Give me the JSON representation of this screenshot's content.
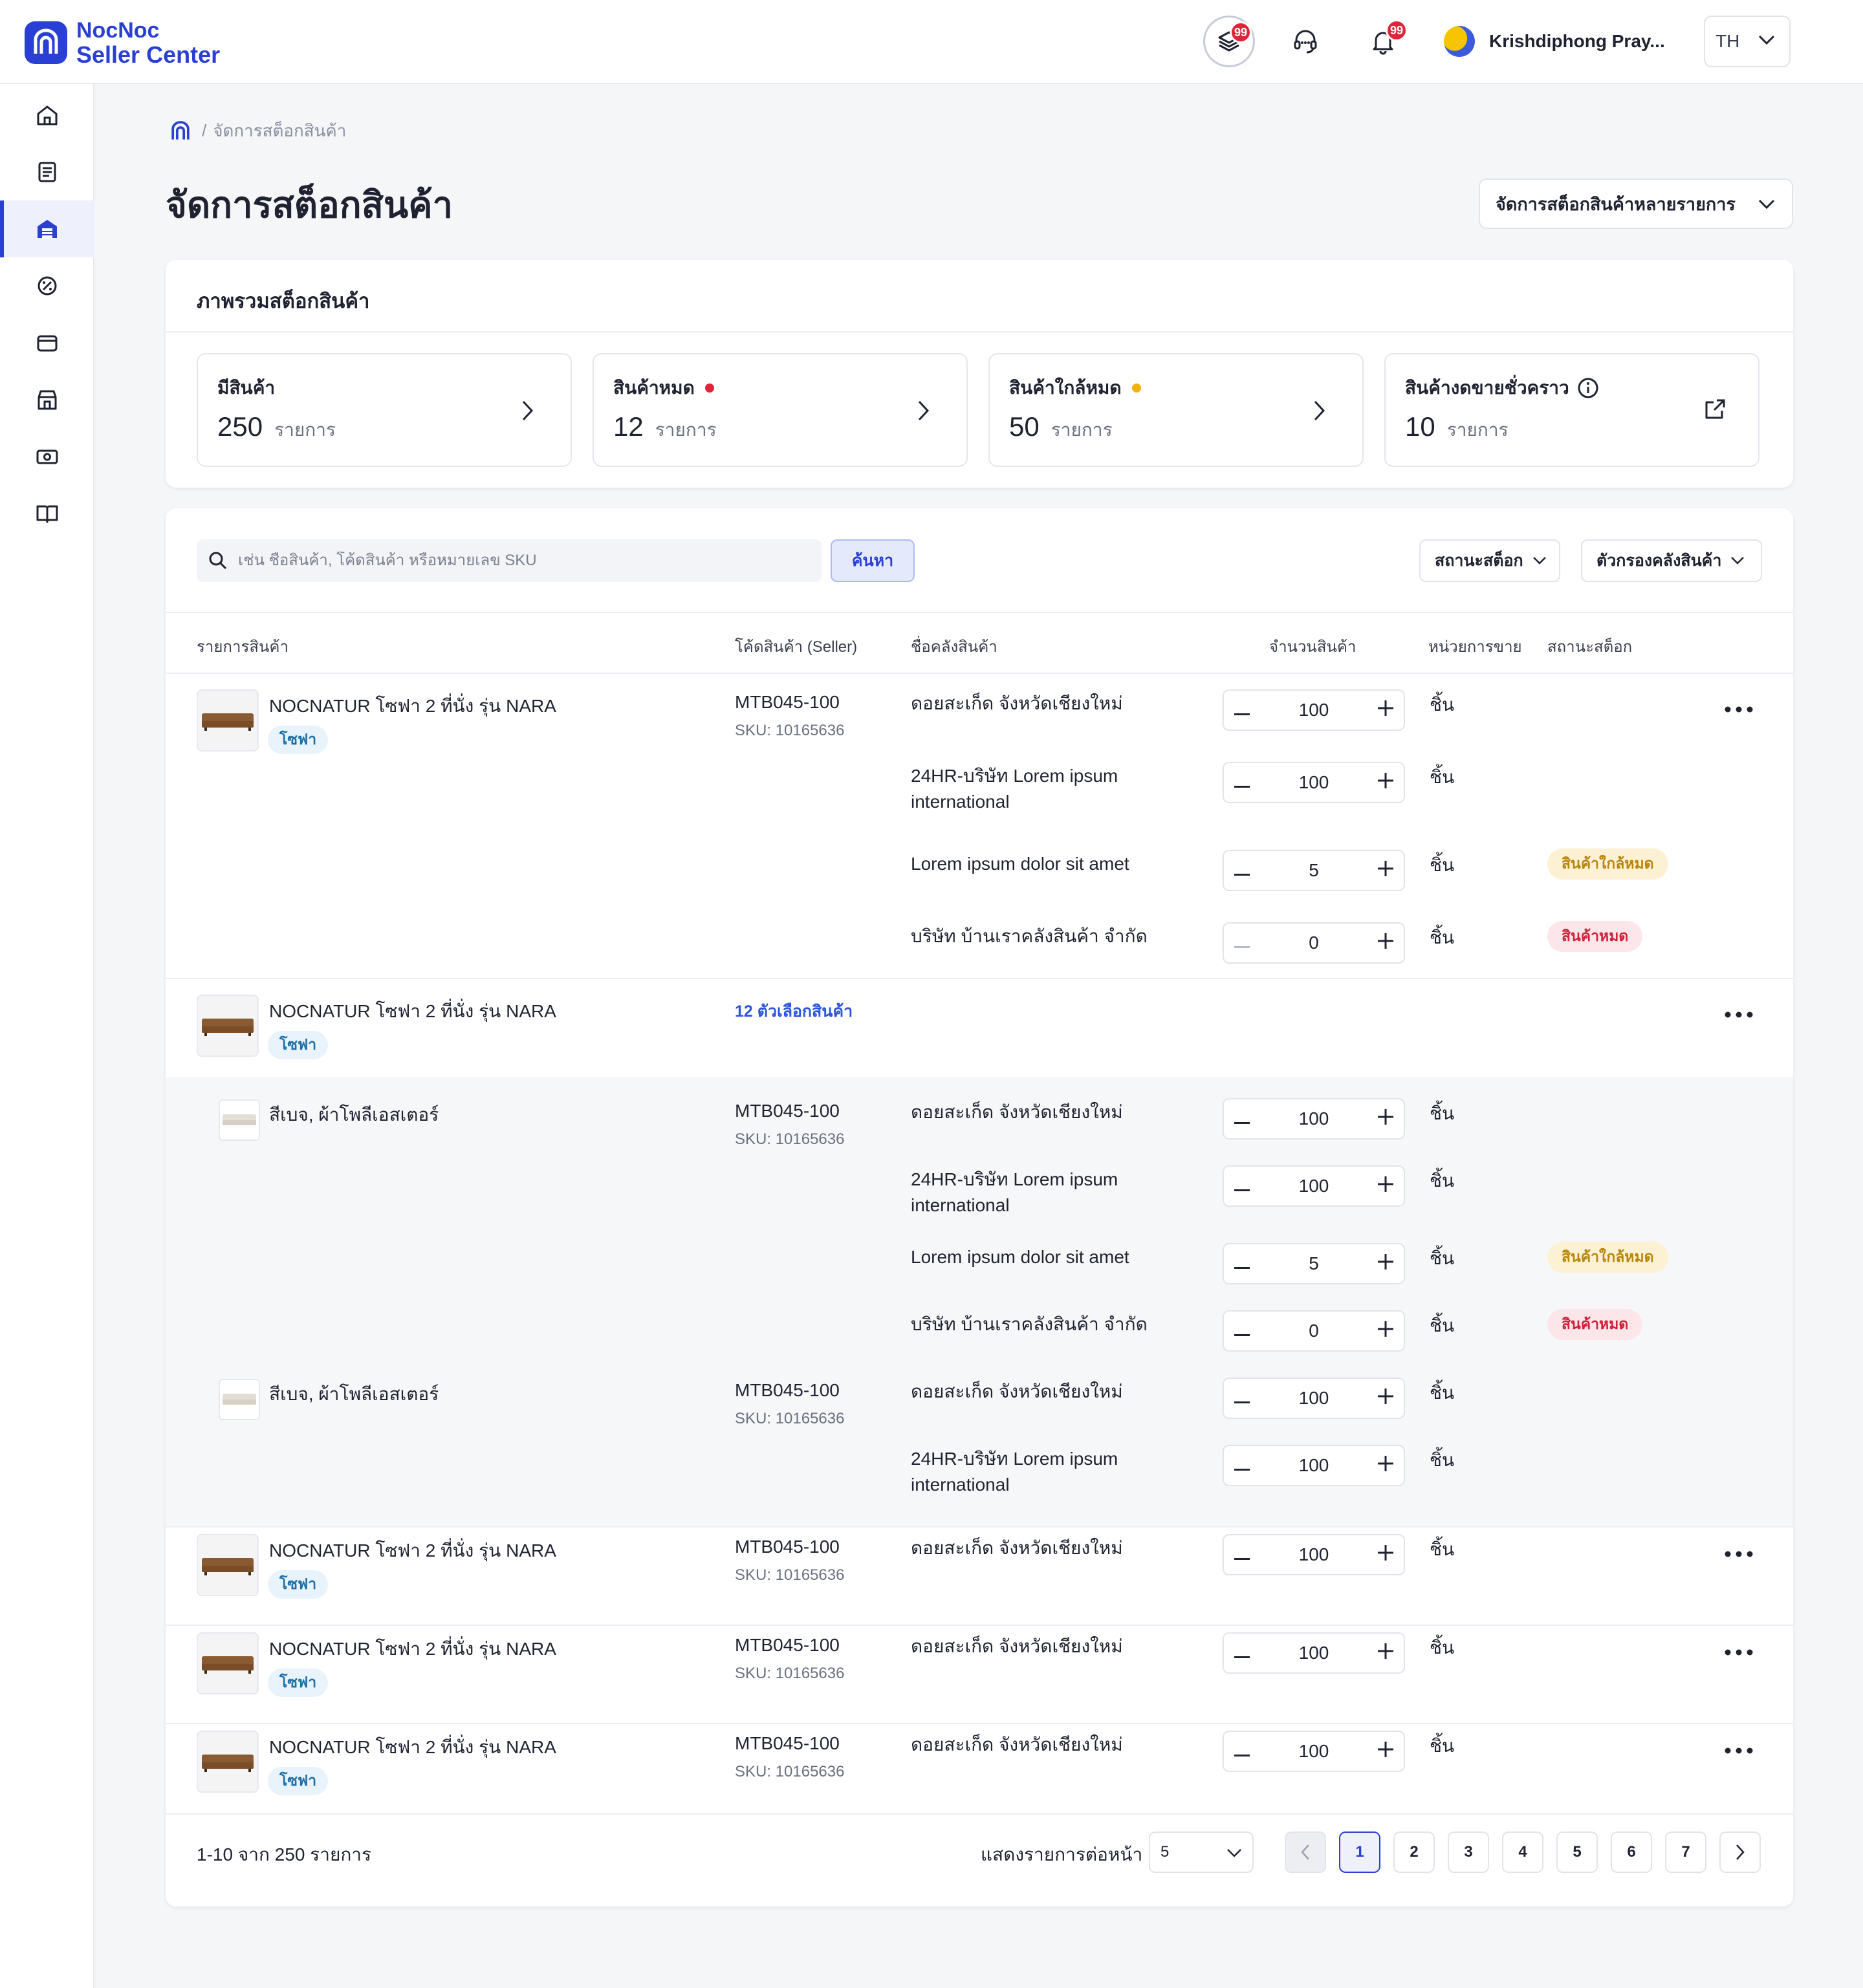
{
  "brand": {
    "line1": "NocNoc",
    "line2": "Seller Center",
    "color": "#2a3fd3"
  },
  "header": {
    "shortcuts_badge": "99",
    "notifications_badge": "99",
    "user_name": "Krishdiphong Pray...",
    "language": "TH"
  },
  "sidebar": {
    "items": [
      {
        "icon": "home-icon"
      },
      {
        "icon": "orders-icon"
      },
      {
        "icon": "stock-icon",
        "active": true
      },
      {
        "icon": "promotion-icon"
      },
      {
        "icon": "payment-card-icon"
      },
      {
        "icon": "store-icon"
      },
      {
        "icon": "finance-icon"
      },
      {
        "icon": "guide-book-icon"
      }
    ]
  },
  "breadcrumb": {
    "current": "จัดการสต็อกสินค้า"
  },
  "page": {
    "title": "จัดการสต็อกสินค้า",
    "bulk_button": "จัดการสต็อกสินค้าหลายรายการ"
  },
  "overview": {
    "title": "ภาพรวมสต็อกสินค้า",
    "stats": [
      {
        "label": "มีสินค้า",
        "value": "250",
        "unit": "รายการ",
        "dot": null
      },
      {
        "label": "สินค้าหมด",
        "value": "12",
        "unit": "รายการ",
        "dot": "#e0243a"
      },
      {
        "label": "สินค้าใกล้หมด",
        "value": "50",
        "unit": "รายการ",
        "dot": "#f2b20f"
      },
      {
        "label": "สินค้างดขายชั่วคราว",
        "value": "10",
        "unit": "รายการ",
        "dot": null
      }
    ]
  },
  "search": {
    "placeholder": "เช่น ชื่อสินค้า, โค้ดสินค้า หรือหมายเลข SKU",
    "button": "ค้นหา"
  },
  "filters": {
    "status": "สถานะสต็อก",
    "warehouse": "ตัวกรองคลังสินค้า"
  },
  "table": {
    "headers": {
      "product": "รายการสินค้า",
      "code": "โค้ดสินค้า (Seller)",
      "warehouse": "ชื่อคลังสินค้า",
      "quantity": "จำนวนสินค้า",
      "unit": "หน่วยการขาย",
      "status": "สถานะสต็อก"
    },
    "product_name": "NOCNATUR โซฟา 2 ที่นั่ง รุ่น NARA",
    "category_tag": "โซฟา",
    "variant_name": "สีเบจ, ผ้าโพลีเอสเตอร์",
    "code": "MTB045-100",
    "sku": "SKU: 10165636",
    "options_link": "12 ตัวเลือกสินค้า",
    "unit": "ชิ้น",
    "warehouses": {
      "w1": "ดอยสะเก็ด จังหวัดเชียงใหม่",
      "w2": "24HR-บริษัท Lorem ipsum international",
      "w3": "Lorem ipsum dolor sit amet",
      "w4": "บริษัท บ้านเราคลังสินค้า จำกัด"
    },
    "quantities": {
      "q100": "100",
      "q5": "5",
      "q0": "0"
    },
    "status": {
      "low": "สินค้าใกล้หมด",
      "out": "สินค้าหมด"
    }
  },
  "pagination": {
    "summary": "1-10 จาก 250 รายการ",
    "per_page_label": "แสดงรายการต่อหน้า",
    "per_page_value": "5",
    "pages": [
      "1",
      "2",
      "3",
      "4",
      "5",
      "6",
      "7"
    ],
    "current_page": "1"
  }
}
